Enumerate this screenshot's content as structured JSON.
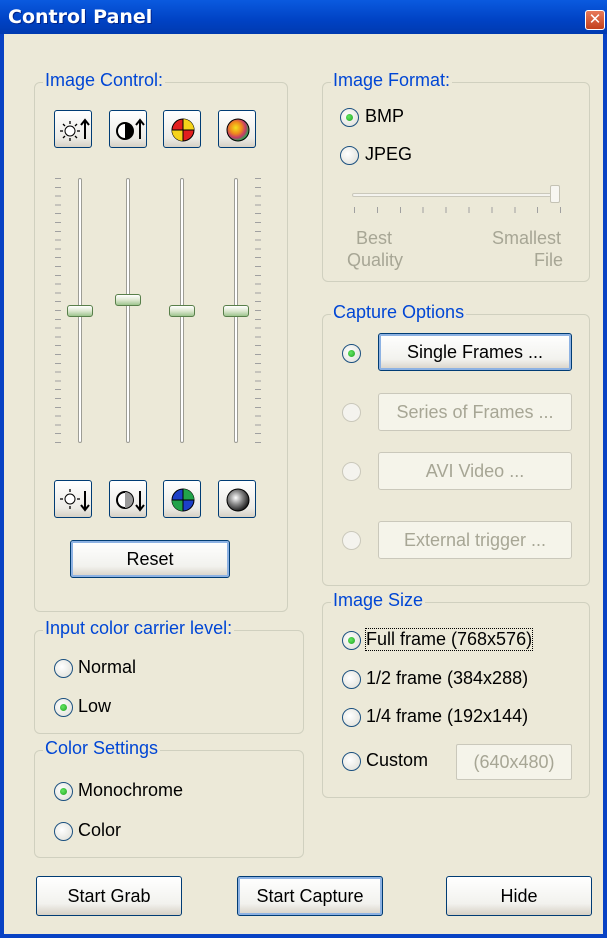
{
  "window": {
    "title": "Control Panel",
    "close_glyph": "✕"
  },
  "image_control": {
    "legend": "Image Control:",
    "top_buttons": [
      {
        "icon": "brightness-up-icon"
      },
      {
        "icon": "contrast-up-icon"
      },
      {
        "icon": "hue-icon"
      },
      {
        "icon": "saturation-icon"
      }
    ],
    "sliders": [
      {
        "name": "brightness",
        "level": 0.5
      },
      {
        "name": "contrast",
        "level": 0.54
      },
      {
        "name": "hue",
        "level": 0.5
      },
      {
        "name": "saturation",
        "level": 0.5
      }
    ],
    "bottom_buttons": [
      {
        "icon": "brightness-down-icon"
      },
      {
        "icon": "contrast-down-icon"
      },
      {
        "icon": "hue-reset-icon"
      },
      {
        "icon": "saturation-down-icon"
      }
    ],
    "reset_label": "Reset"
  },
  "image_format": {
    "legend": "Image Format:",
    "options": [
      {
        "label": "BMP",
        "selected": true
      },
      {
        "label": "JPEG",
        "selected": false
      }
    ],
    "quality_slider": {
      "level": 1.0,
      "left_label_1": "Best",
      "left_label_2": "Quality",
      "right_label_1": "Smallest",
      "right_label_2": "File"
    }
  },
  "capture_options": {
    "legend": "Capture Options",
    "options": [
      {
        "label": "Single Frames ...",
        "selected": true,
        "enabled": true
      },
      {
        "label": "Series of Frames ...",
        "selected": false,
        "enabled": false
      },
      {
        "label": "AVI Video ...",
        "selected": false,
        "enabled": false
      },
      {
        "label": "External trigger ...",
        "selected": false,
        "enabled": false
      }
    ]
  },
  "input_color_carrier": {
    "legend": "Input color carrier level:",
    "options": [
      {
        "label": "Normal",
        "selected": false
      },
      {
        "label": "Low",
        "selected": true
      }
    ]
  },
  "color_settings": {
    "legend": "Color Settings",
    "options": [
      {
        "label": "Monochrome",
        "selected": true
      },
      {
        "label": "Color",
        "selected": false
      }
    ]
  },
  "image_size": {
    "legend": "Image Size",
    "options": [
      {
        "label": "Full frame (768x576)",
        "selected": true
      },
      {
        "label": "1/2 frame (384x288)",
        "selected": false
      },
      {
        "label": "1/4 frame (192x144)",
        "selected": false
      },
      {
        "label": "Custom",
        "selected": false
      }
    ],
    "custom_value": "(640x480)"
  },
  "footer": {
    "start_grab": "Start Grab",
    "start_capture": "Start Capture",
    "hide": "Hide"
  },
  "colors": {
    "accent": "#0046d5",
    "title_bar": "#0042c4",
    "face": "#ece9d8"
  }
}
